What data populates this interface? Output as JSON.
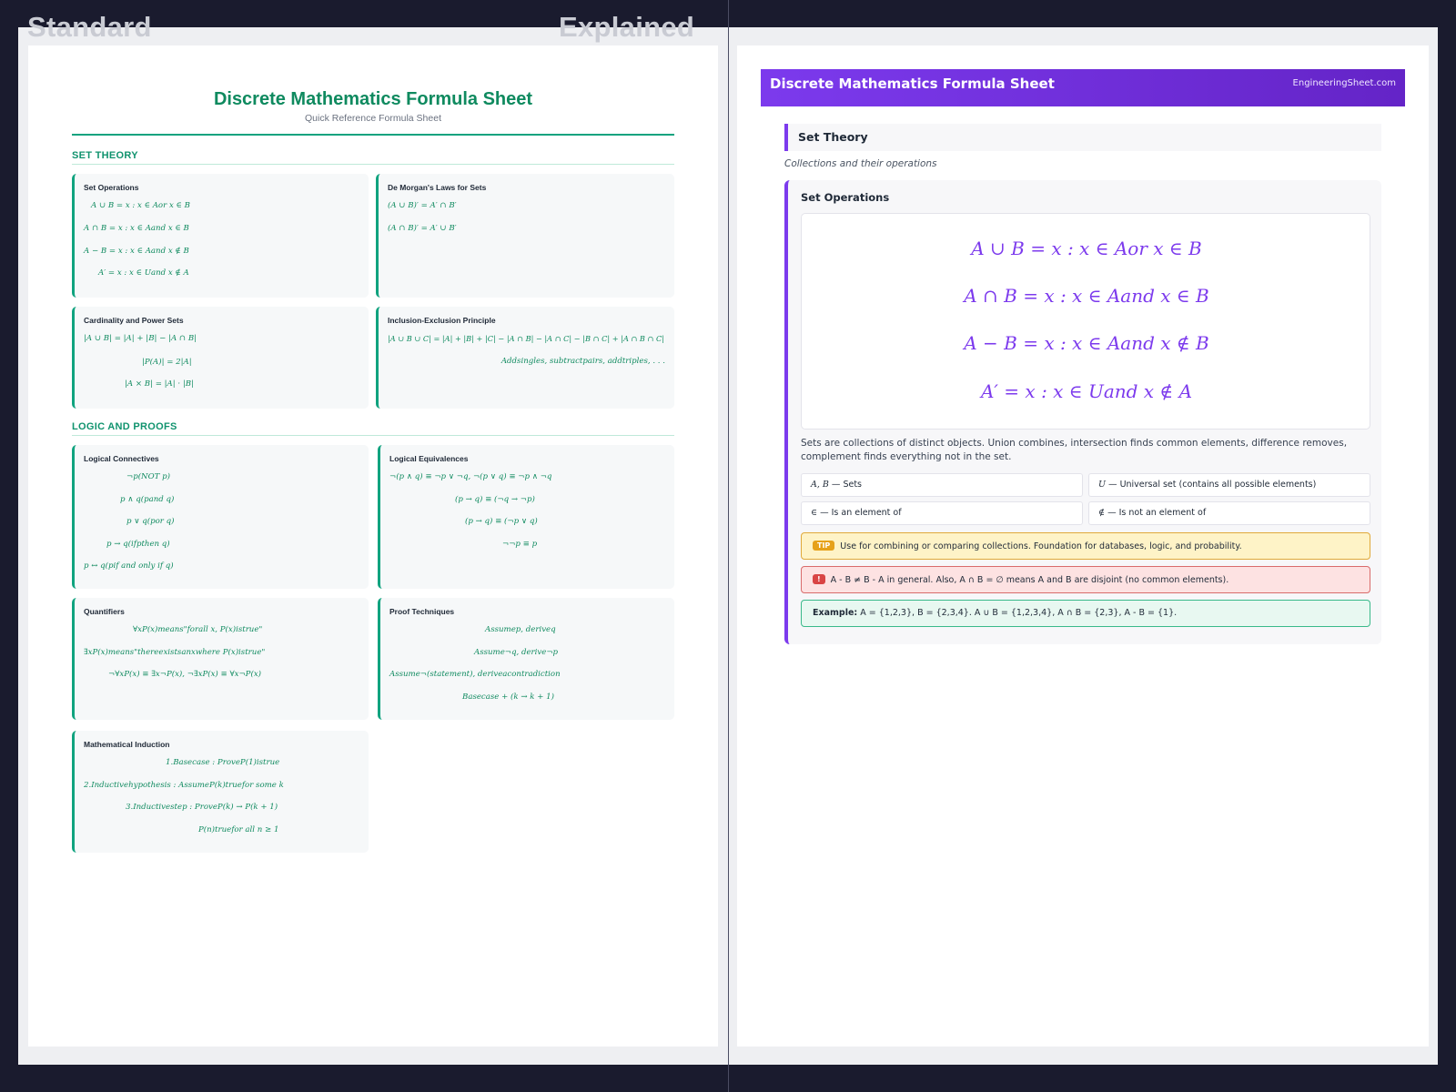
{
  "labels": {
    "standard": "Standard",
    "explained": "Explained"
  },
  "standard": {
    "title": "Discrete Mathematics Formula Sheet",
    "subtitle": "Quick Reference Formula Sheet",
    "sections": [
      {
        "title": "SET THEORY",
        "cards": [
          {
            "title": "Set Operations",
            "formulas": [
              "A ∪ B = x : x ∈ Aor x ∈ B",
              "A ∩ B = x : x ∈ Aand x ∈ B",
              "A − B = x : x ∈ Aand x ∉ B",
              "A′ = x : x ∈ Uand x ∉ A"
            ]
          },
          {
            "title": "De Morgan's Laws for Sets",
            "formulas": [
              "(A ∪ B)′ = A′ ∩ B′",
              "(A ∩ B)′ = A′ ∪ B′"
            ]
          },
          {
            "title": "Cardinality and Power Sets",
            "formulas": [
              "|A ∪ B| = |A| + |B| − |A ∩ B|",
              "|P(A)| = 2|A|",
              "|A × B| = |A| · |B|"
            ]
          },
          {
            "title": "Inclusion-Exclusion Principle",
            "formulas": [
              "|A ∪ B ∪ C| = |A| + |B| + |C| − |A ∩ B| − |A ∩ C| − |B ∩ C| + |A ∩ B ∩ C|",
              "Addsingles, subtractpairs, addtriples, . . ."
            ]
          }
        ]
      },
      {
        "title": "LOGIC AND PROOFS",
        "cards": [
          {
            "title": "Logical Connectives",
            "formulas": [
              "¬p(NOT p)",
              "p ∧ q(pand q)",
              "p ∨ q(por q)",
              "p → q(ifpthen q)",
              "p ↔ q(pif and only if q)"
            ]
          },
          {
            "title": "Logical Equivalences",
            "formulas": [
              "¬(p ∧ q) ≡ ¬p ∨ ¬q, ¬(p ∨ q) ≡ ¬p ∧ ¬q",
              "(p → q) ≡ (¬q → ¬p)",
              "(p → q) ≡ (¬p ∨ q)",
              "¬¬p ≡ p"
            ]
          },
          {
            "title": "Quantifiers",
            "formulas": [
              "∀xP(x)means\"forall x, P(x)istrue\"",
              "∃xP(x)means\"thereexistsanxwhere P(x)istrue\"",
              "¬∀xP(x) ≡ ∃x¬P(x), ¬∃xP(x) ≡ ∀x¬P(x)"
            ]
          },
          {
            "title": "Proof Techniques",
            "formulas": [
              "Assumep, deriveq",
              "Assume¬q, derive¬p",
              "Assume¬(statement), deriveacontradiction",
              "Basecase + (k → k + 1)"
            ]
          },
          {
            "title": "Mathematical Induction",
            "formulas": [
              "1.Basecase : ProveP(1)istrue",
              "2.Inductivehypothesis : AssumeP(k)truefor some k",
              "3.Inductivestep : ProveP(k) → P(k + 1)",
              "P(n)truefor all n ≥ 1"
            ]
          }
        ]
      }
    ]
  },
  "explained": {
    "header_title": "Discrete Mathematics Formula Sheet",
    "header_site": "EngineeringSheet.com",
    "section_title": "Set Theory",
    "section_desc": "Collections and their operations",
    "card_title": "Set Operations",
    "formulas": [
      "A ∪ B = x : x ∈ Aor x ∈ B",
      "A ∩ B = x : x ∈ Aand x ∈ B",
      "A − B = x : x ∈ Aand x ∉ B",
      "A′ = x : x ∈ Uand x ∉ A"
    ],
    "description": "Sets are collections of distinct objects. Union combines, intersection finds common elements, difference removes, complement finds everything not in the set.",
    "variables": [
      {
        "symbol": "A, B",
        "text": "— Sets"
      },
      {
        "symbol": "U",
        "text": "— Universal set (contains all possible elements)"
      },
      {
        "symbol": "∈",
        "text": "— Is an element of"
      },
      {
        "symbol": "∉",
        "text": "— Is not an element of"
      }
    ],
    "tip_badge": "TIP",
    "tip_text": "Use for combining or comparing collections. Foundation for databases, logic, and probability.",
    "warn_badge": "!",
    "warn_text": "A - B ≠ B - A in general. Also, A ∩ B = ∅ means A and B are disjoint (no common elements).",
    "example_label": "Example:",
    "example_text": "A = {1,2,3}, B = {2,3,4}. A ∪ B = {1,2,3,4}, A ∩ B = {2,3}, A - B = {1}."
  }
}
